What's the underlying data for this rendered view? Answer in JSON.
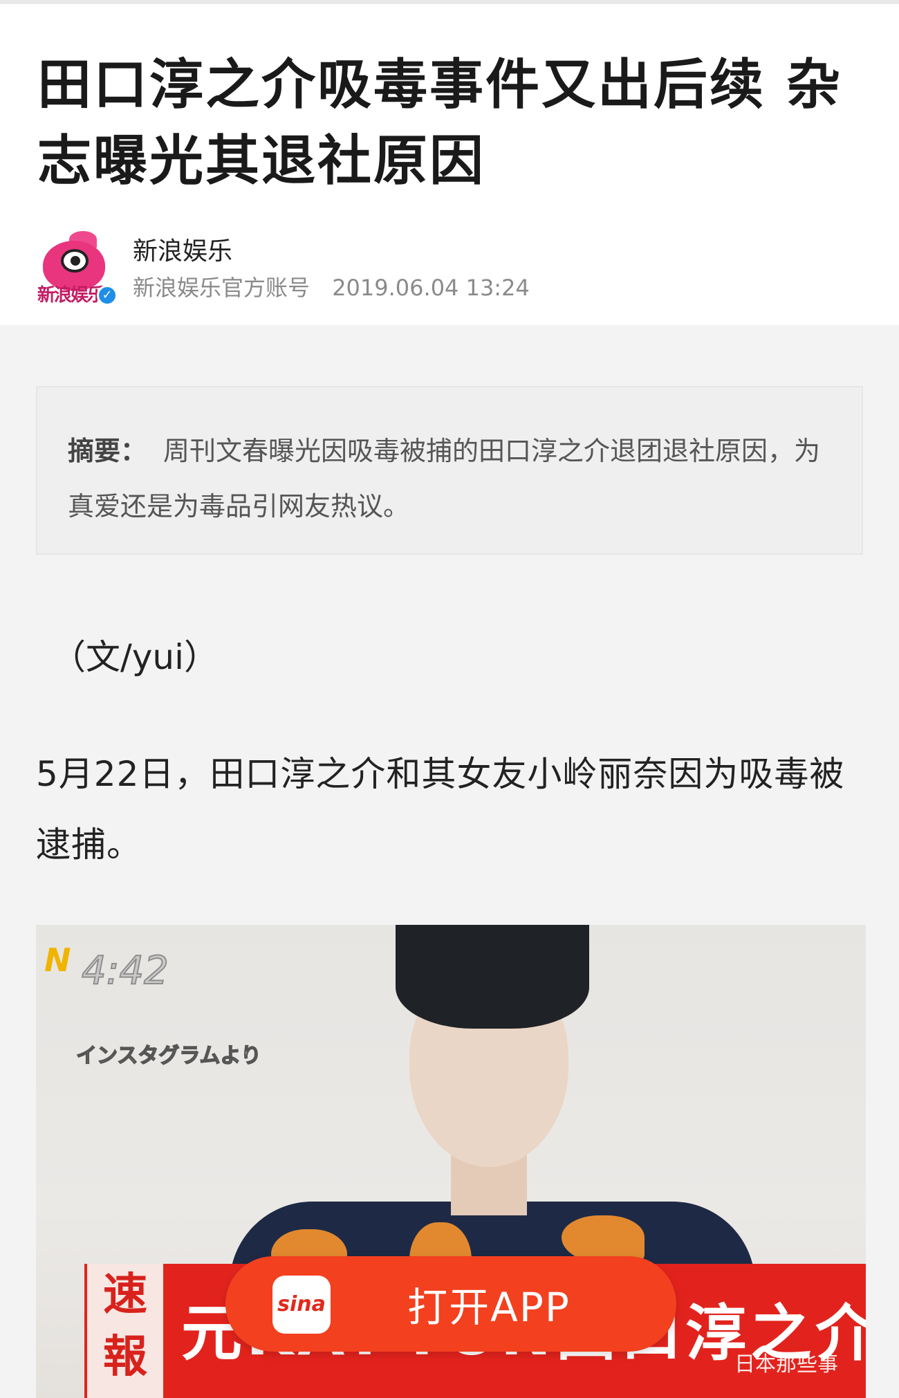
{
  "article": {
    "title": "田口淳之介吸毒事件又出后续 杂志曝光其退社原因",
    "author": {
      "name": "新浪娱乐",
      "account_type": "新浪娱乐官方账号",
      "datetime": "2019.06.04  13:24",
      "avatar_text": "新浪娱乐",
      "verified_mark": "✓"
    },
    "summary": {
      "label": "摘要：",
      "text": "周刊文春曝光因吸毒被捕的田口淳之介退团退社原因，为真爱还是为毒品引网友热议。"
    },
    "byline": "（文/yui）",
    "paragraph": "5月22日，田口淳之介和其女友小岭丽奈因为吸毒被逮捕。",
    "photo": {
      "channel_mark": "N",
      "time": "4:42",
      "caption": "インスタグラムより",
      "breaking": "速報",
      "banner_text": "元KAT-TUN田口淳之介を逮捕",
      "watermark": "日本那些事"
    }
  },
  "open_app": {
    "logo_text": "sina",
    "label": "打开APP"
  },
  "colors": {
    "accent": "#f3401f",
    "verified": "#1e8ee8",
    "summary_bg": "#efefef"
  }
}
